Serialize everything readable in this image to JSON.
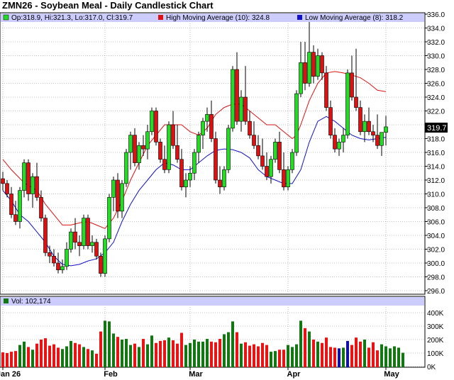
{
  "title": "ZMN26 - Soybean Meal - Daily Candlestick Chart",
  "legend": {
    "ohlc_label": "Op:318.9, Hi:321.3, Lo:317.0, Cl:319.7",
    "high_ma_label": "High Moving Average (10): 324.8",
    "low_ma_label": "Low Moving Average (8): 318.2",
    "vol_label": "Vol: 102,174"
  },
  "last_price_label": "319.7",
  "colors": {
    "up": "#22dd22",
    "down": "#dd1111",
    "high_ma": "#dd1111",
    "low_ma": "#1111cc",
    "vol_up": "#117711",
    "vol_down": "#ee1111",
    "vol_neutral": "#1111aa",
    "legend_bg": "#ccccff",
    "grid": "#888888"
  },
  "chart_data": [
    {
      "type": "candlestick",
      "title": "ZMN26 - Soybean Meal - Daily Candlestick Chart",
      "ylim": [
        296,
        336
      ],
      "y_ticks": [
        "336.0",
        "334.0",
        "332.0",
        "330.0",
        "328.0",
        "326.0",
        "324.0",
        "322.0",
        "320.0",
        "318.0",
        "316.0",
        "314.0",
        "312.0",
        "310.0",
        "308.0",
        "306.0",
        "304.0",
        "302.0",
        "300.0",
        "298.0",
        "296.0"
      ],
      "x_ticks": [
        {
          "label": "Jan 26",
          "index": 0
        },
        {
          "label": "Feb",
          "index": 24
        },
        {
          "label": "Mar",
          "index": 44
        },
        {
          "label": "Apr",
          "index": 67
        },
        {
          "label": "May",
          "index": 90
        }
      ],
      "grid": true,
      "candles": [
        [
          312.2,
          313.2,
          310.5,
          311.5
        ],
        [
          311.5,
          312.0,
          309.5,
          310.0
        ],
        [
          310.0,
          311.0,
          306.5,
          307.0
        ],
        [
          307.0,
          309.0,
          305.5,
          306.0
        ],
        [
          306.0,
          311.0,
          305.0,
          310.5
        ],
        [
          310.5,
          315.0,
          309.5,
          314.5
        ],
        [
          314.5,
          315.0,
          309.0,
          310.0
        ],
        [
          310.0,
          313.0,
          308.0,
          312.5
        ],
        [
          312.5,
          314.5,
          309.0,
          309.5
        ],
        [
          309.5,
          310.5,
          306.0,
          306.5
        ],
        [
          306.5,
          307.0,
          301.0,
          301.5
        ],
        [
          301.5,
          302.5,
          300.0,
          301.0
        ],
        [
          301.0,
          302.0,
          299.5,
          300.0
        ],
        [
          300.0,
          301.5,
          298.5,
          299.0
        ],
        [
          299.0,
          300.5,
          298.5,
          299.5
        ],
        [
          299.5,
          303.0,
          299.0,
          302.0
        ],
        [
          302.0,
          305.0,
          301.5,
          304.5
        ],
        [
          304.5,
          306.5,
          302.0,
          303.0
        ],
        [
          303.0,
          304.0,
          301.0,
          302.5
        ],
        [
          302.5,
          307.0,
          302.0,
          306.5
        ],
        [
          306.5,
          307.0,
          302.0,
          302.5
        ],
        [
          302.5,
          304.0,
          301.5,
          303.0
        ],
        [
          303.0,
          303.5,
          300.5,
          301.0
        ],
        [
          301.0,
          301.5,
          298.0,
          298.5
        ],
        [
          298.5,
          304.0,
          298.0,
          303.5
        ],
        [
          303.5,
          310.0,
          303.0,
          309.5
        ],
        [
          309.5,
          312.5,
          307.5,
          312.0
        ],
        [
          312.0,
          313.0,
          306.5,
          307.5
        ],
        [
          307.5,
          312.0,
          306.5,
          311.5
        ],
        [
          311.5,
          316.5,
          311.0,
          316.0
        ],
        [
          316.0,
          319.0,
          313.5,
          318.5
        ],
        [
          318.5,
          319.5,
          314.0,
          314.5
        ],
        [
          314.5,
          317.5,
          313.5,
          317.0
        ],
        [
          317.0,
          318.5,
          315.5,
          316.5
        ],
        [
          316.5,
          320.0,
          315.0,
          319.0
        ],
        [
          319.0,
          322.5,
          318.5,
          322.0
        ],
        [
          322.0,
          322.5,
          317.0,
          317.5
        ],
        [
          317.5,
          318.0,
          314.5,
          315.0
        ],
        [
          315.0,
          317.0,
          313.0,
          313.5
        ],
        [
          313.5,
          320.5,
          313.0,
          320.0
        ],
        [
          320.0,
          322.0,
          316.5,
          317.0
        ],
        [
          317.0,
          320.0,
          314.5,
          315.0
        ],
        [
          315.0,
          316.5,
          310.5,
          311.0
        ],
        [
          311.0,
          313.0,
          309.5,
          312.0
        ],
        [
          312.0,
          314.0,
          311.0,
          313.0
        ],
        [
          313.0,
          316.5,
          312.0,
          316.0
        ],
        [
          316.0,
          319.0,
          314.5,
          318.5
        ],
        [
          318.5,
          321.0,
          316.5,
          320.5
        ],
        [
          320.5,
          322.5,
          319.0,
          321.5
        ],
        [
          321.5,
          323.5,
          317.5,
          318.0
        ],
        [
          318.0,
          319.0,
          311.5,
          312.0
        ],
        [
          312.0,
          314.0,
          310.0,
          311.0
        ],
        [
          311.0,
          314.0,
          310.5,
          313.5
        ],
        [
          313.5,
          320.0,
          313.0,
          319.5
        ],
        [
          319.5,
          328.5,
          319.0,
          328.0
        ],
        [
          328.0,
          330.5,
          320.0,
          320.5
        ],
        [
          320.5,
          325.0,
          319.0,
          324.0
        ],
        [
          324.0,
          328.5,
          320.0,
          320.5
        ],
        [
          320.5,
          322.0,
          318.0,
          318.5
        ],
        [
          318.5,
          320.5,
          316.5,
          317.0
        ],
        [
          317.0,
          318.5,
          315.0,
          315.5
        ],
        [
          315.5,
          318.0,
          313.5,
          314.0
        ],
        [
          314.0,
          316.0,
          312.0,
          312.5
        ],
        [
          312.5,
          315.5,
          311.5,
          315.0
        ],
        [
          315.0,
          318.0,
          314.5,
          317.5
        ],
        [
          317.5,
          319.0,
          313.0,
          313.5
        ],
        [
          313.5,
          316.0,
          310.5,
          311.0
        ],
        [
          311.0,
          314.0,
          310.5,
          313.5
        ],
        [
          313.5,
          316.5,
          313.0,
          316.0
        ],
        [
          316.0,
          325.0,
          315.5,
          324.5
        ],
        [
          324.5,
          332.0,
          324.0,
          329.0
        ],
        [
          329.0,
          332.0,
          325.0,
          326.0
        ],
        [
          326.0,
          335.0,
          325.5,
          330.5
        ],
        [
          330.5,
          331.5,
          326.0,
          327.0
        ],
        [
          327.0,
          331.0,
          326.5,
          330.0
        ],
        [
          330.0,
          330.5,
          326.5,
          327.5
        ],
        [
          327.5,
          328.5,
          322.0,
          322.5
        ],
        [
          322.5,
          323.5,
          318.0,
          318.5
        ],
        [
          318.5,
          319.5,
          316.0,
          316.5
        ],
        [
          316.5,
          318.0,
          315.5,
          317.5
        ],
        [
          317.5,
          319.5,
          316.0,
          318.5
        ],
        [
          318.5,
          328.0,
          318.0,
          327.5
        ],
        [
          327.5,
          330.0,
          323.5,
          324.0
        ],
        [
          324.0,
          331.0,
          322.0,
          322.5
        ],
        [
          322.5,
          323.5,
          318.5,
          319.0
        ],
        [
          319.0,
          321.5,
          317.5,
          320.5
        ],
        [
          320.5,
          322.5,
          318.5,
          319.0
        ],
        [
          319.0,
          320.0,
          317.5,
          318.5
        ],
        [
          318.5,
          321.5,
          316.5,
          317.0
        ],
        [
          317.0,
          318.5,
          315.5,
          318.9
        ],
        [
          318.9,
          321.3,
          317.0,
          319.7
        ]
      ],
      "high_ma_10": [
        [
          0,
          315.0
        ],
        [
          2,
          313.5
        ],
        [
          5,
          311.6
        ],
        [
          8,
          310.5
        ],
        [
          10,
          308.5
        ],
        [
          12,
          307.0
        ],
        [
          14,
          305.5
        ],
        [
          16,
          305.5
        ],
        [
          18,
          305.8
        ],
        [
          20,
          306.0
        ],
        [
          22,
          305.5
        ],
        [
          24,
          305.0
        ],
        [
          26,
          306.5
        ],
        [
          28,
          309.0
        ],
        [
          30,
          312.0
        ],
        [
          32,
          314.5
        ],
        [
          34,
          317.0
        ],
        [
          36,
          318.5
        ],
        [
          38,
          320.0
        ],
        [
          40,
          320.0
        ],
        [
          42,
          320.0
        ],
        [
          44,
          319.0
        ],
        [
          46,
          318.5
        ],
        [
          48,
          319.5
        ],
        [
          50,
          321.5
        ],
        [
          52,
          322.5
        ],
        [
          54,
          323.0
        ],
        [
          56,
          323.0
        ],
        [
          58,
          322.0
        ],
        [
          60,
          321.0
        ],
        [
          62,
          320.0
        ],
        [
          64,
          320.0
        ],
        [
          66,
          319.0
        ],
        [
          67,
          318.5
        ],
        [
          68,
          318.0
        ],
        [
          69,
          318.5
        ],
        [
          70,
          320.0
        ],
        [
          72,
          323.5
        ],
        [
          74,
          326.0
        ],
        [
          76,
          327.5
        ],
        [
          78,
          327.7
        ],
        [
          80,
          327.5
        ],
        [
          82,
          327.2
        ],
        [
          84,
          326.8
        ],
        [
          86,
          326.0
        ],
        [
          88,
          325.0
        ],
        [
          90,
          324.8
        ]
      ],
      "low_ma_8": [
        [
          0,
          310.5
        ],
        [
          2,
          309.0
        ],
        [
          4,
          307.0
        ],
        [
          6,
          306.0
        ],
        [
          8,
          304.5
        ],
        [
          10,
          303.0
        ],
        [
          12,
          301.0
        ],
        [
          14,
          299.8
        ],
        [
          16,
          299.6
        ],
        [
          18,
          299.8
        ],
        [
          20,
          300.3
        ],
        [
          22,
          300.6
        ],
        [
          24,
          301.5
        ],
        [
          26,
          303.0
        ],
        [
          28,
          306.0
        ],
        [
          30,
          308.5
        ],
        [
          32,
          310.5
        ],
        [
          34,
          312.0
        ],
        [
          36,
          313.5
        ],
        [
          38,
          314.5
        ],
        [
          40,
          314.2
        ],
        [
          42,
          313.5
        ],
        [
          44,
          313.5
        ],
        [
          46,
          314.5
        ],
        [
          48,
          315.5
        ],
        [
          50,
          316.3
        ],
        [
          52,
          316.5
        ],
        [
          54,
          316.4
        ],
        [
          56,
          316.0
        ],
        [
          58,
          315.2
        ],
        [
          60,
          313.5
        ],
        [
          62,
          312.5
        ],
        [
          64,
          312.0
        ],
        [
          66,
          311.5
        ],
        [
          68,
          311.5
        ],
        [
          70,
          313.5
        ],
        [
          72,
          317.5
        ],
        [
          74,
          320.5
        ],
        [
          76,
          321.2
        ],
        [
          78,
          320.5
        ],
        [
          80,
          319.5
        ],
        [
          82,
          318.5
        ],
        [
          84,
          318.0
        ],
        [
          86,
          317.8
        ],
        [
          88,
          318.0
        ],
        [
          90,
          318.2
        ]
      ]
    },
    {
      "type": "bar",
      "title": "Vol: 102,174",
      "ylim": [
        0,
        400000
      ],
      "y_ticks": [
        "400K",
        "300K",
        "200K",
        "100K",
        "0K"
      ],
      "values": [
        105000,
        100000,
        110000,
        115000,
        160000,
        185000,
        145000,
        125000,
        170000,
        200000,
        210000,
        155000,
        165000,
        140000,
        130000,
        150000,
        190000,
        175000,
        165000,
        145000,
        130000,
        120000,
        95000,
        260000,
        340000,
        335000,
        245000,
        220000,
        200000,
        205000,
        160000,
        170000,
        145000,
        205000,
        165000,
        230000,
        175000,
        190000,
        195000,
        215000,
        195000,
        170000,
        250000,
        160000,
        175000,
        200000,
        185000,
        185000,
        205000,
        185000,
        180000,
        205000,
        240000,
        255000,
        335000,
        255000,
        170000,
        180000,
        155000,
        165000,
        150000,
        175000,
        160000,
        110000,
        115000,
        125000,
        125000,
        160000,
        145000,
        165000,
        340000,
        285000,
        260000,
        200000,
        185000,
        175000,
        215000,
        145000,
        140000,
        135000,
        140000,
        190000,
        160000,
        215000,
        185000,
        200000,
        140000,
        180000,
        120000,
        165000,
        150000,
        135000,
        150000,
        140000,
        102174
      ],
      "neutral_bars": [
        79,
        81
      ]
    }
  ]
}
